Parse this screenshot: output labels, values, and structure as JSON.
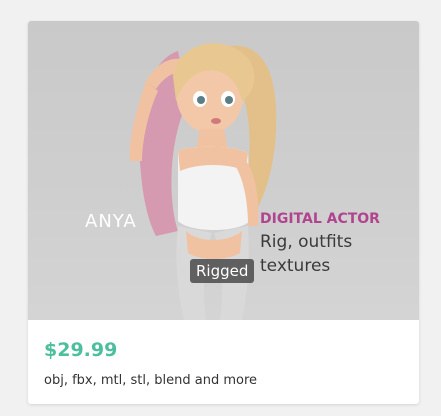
{
  "product": {
    "actor_name": "ANYA",
    "actor_title": "DIGITAL ACTOR",
    "actor_desc_line1": "Rig, outfits",
    "actor_desc_line2": "textures",
    "badge": "Rigged",
    "price": "$29.99",
    "formats": "obj, fbx, mtl, stl, blend and more"
  },
  "colors": {
    "price": "#4dbf9e",
    "actor_title": "#b0448f",
    "badge_bg": "#464646"
  }
}
